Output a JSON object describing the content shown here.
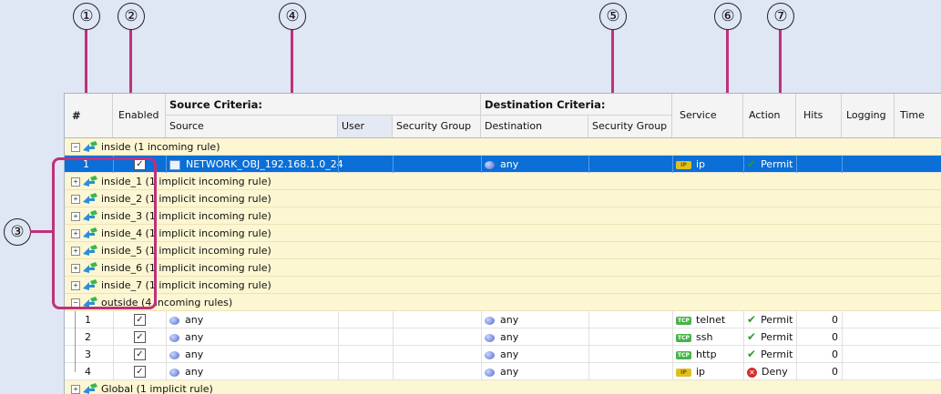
{
  "callouts": [
    "①",
    "②",
    "③",
    "④",
    "⑤",
    "⑥",
    "⑦"
  ],
  "header": {
    "num": "#",
    "enabled": "Enabled",
    "source_criteria": "Source Criteria:",
    "source": "Source",
    "user": "User",
    "src_security_group": "Security Group",
    "destination_criteria": "Destination Criteria:",
    "destination": "Destination",
    "dst_security_group": "Security Group",
    "service": "Service",
    "action": "Action",
    "hits": "Hits",
    "logging": "Logging",
    "time": "Time"
  },
  "groups": {
    "inside": "inside (1 incoming rule)",
    "implicit": [
      "inside_1 (1 implicit incoming rule)",
      "inside_2 (1 implicit incoming rule)",
      "inside_3 (1 implicit incoming rule)",
      "inside_4 (1 implicit incoming rule)",
      "inside_5 (1 implicit incoming rule)",
      "inside_6 (1 implicit incoming rule)",
      "inside_7 (1 implicit incoming rule)"
    ],
    "outside": "outside (4 incoming rules)",
    "global": "Global (1 implicit rule)"
  },
  "selected_rule": {
    "num": "1",
    "source": "NETWORK_OBJ_192.168.1.0_24",
    "destination": "any",
    "service": "ip",
    "action": "Permit"
  },
  "outside_rules": [
    {
      "num": "1",
      "source": "any",
      "destination": "any",
      "service": "telnet",
      "service_icon": "tcp",
      "action": "Permit",
      "action_icon": "check",
      "hits": "0"
    },
    {
      "num": "2",
      "source": "any",
      "destination": "any",
      "service": "ssh",
      "service_icon": "tcp",
      "action": "Permit",
      "action_icon": "check",
      "hits": "0"
    },
    {
      "num": "3",
      "source": "any",
      "destination": "any",
      "service": "http",
      "service_icon": "tcp",
      "action": "Permit",
      "action_icon": "check",
      "hits": "0"
    },
    {
      "num": "4",
      "source": "any",
      "destination": "any",
      "service": "ip",
      "service_icon": "ip",
      "action": "Deny",
      "action_icon": "deny",
      "hits": "0"
    }
  ],
  "icons": {
    "tcp_label": "TCP",
    "ip_label": "IP",
    "checkbox": "✓",
    "permit": "✔",
    "deny": "✕",
    "expand": "+",
    "collapse": "−"
  },
  "colors": {
    "annotation": "#c0307a",
    "selected_row": "#0a6fd6",
    "group_row": "#fcf6d2"
  }
}
